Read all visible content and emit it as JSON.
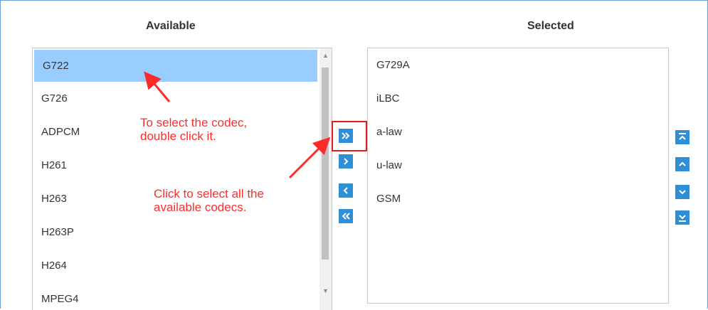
{
  "available": {
    "header": "Available",
    "items": [
      "G722",
      "G726",
      "ADPCM",
      "H261",
      "H263",
      "H263P",
      "H264",
      "MPEG4"
    ],
    "selected_index": 0
  },
  "selected": {
    "header": "Selected",
    "items": [
      "G729A",
      "iLBC",
      "a-law",
      "u-law",
      "GSM"
    ]
  },
  "transfer_buttons": {
    "add_all": "»",
    "add": "›",
    "remove": "‹",
    "remove_all": "«"
  },
  "order_buttons": [
    "move-to-top-icon",
    "move-up-icon",
    "move-down-icon",
    "move-to-bottom-icon"
  ],
  "annotations": {
    "select_codec": "To select the codec,\ndouble click it.",
    "select_all": "Click to select all the\navailable codecs."
  },
  "colors": {
    "accent": "#2f8fd6",
    "selection": "#99ccff",
    "annotation": "#ff2b2b",
    "frame_border": "#6aa0d8"
  }
}
